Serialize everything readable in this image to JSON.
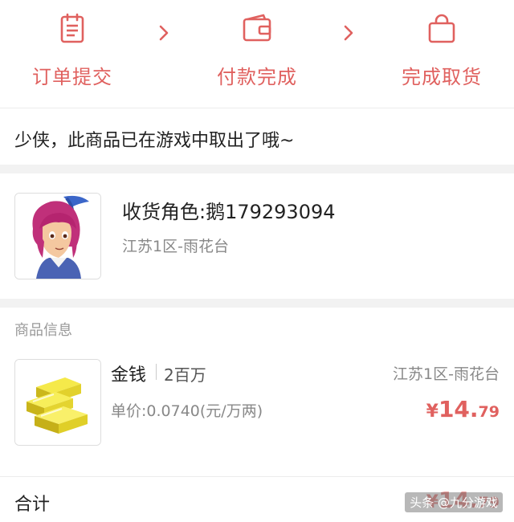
{
  "steps": [
    {
      "label": "订单提交",
      "icon": "clipboard-icon"
    },
    {
      "label": "付款完成",
      "icon": "wallet-icon"
    },
    {
      "label": "完成取货",
      "icon": "shopping-bag-icon"
    }
  ],
  "notice": {
    "text": "少侠，此商品已在游戏中取出了哦~"
  },
  "character": {
    "role_name": "收货角色:鹅179293094",
    "server": "江苏1区-雨花台"
  },
  "product": {
    "section_title": "商品信息",
    "name": "金钱",
    "quantity": "2百万",
    "server": "江苏1区-雨花台",
    "unit_price": "单价:0.0740(元/万两)",
    "price_symbol": "¥",
    "price_integer": "14.",
    "price_decimal": "79"
  },
  "total": {
    "label": "合计",
    "symbol": "¥",
    "integer": "14.",
    "decimal": "79"
  },
  "watermark": "头条 @九分游戏",
  "colors": {
    "accent": "#e0615f",
    "divider": "#f2f2f2",
    "muted": "#888888"
  }
}
